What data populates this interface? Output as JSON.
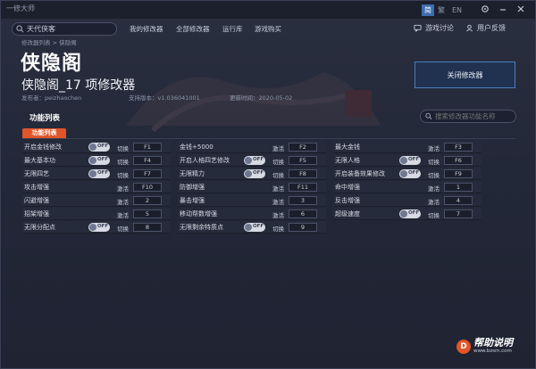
{
  "window": {
    "title": "一修大师"
  },
  "language": {
    "active": "简",
    "options": [
      "繁",
      "EN"
    ]
  },
  "search": {
    "value": "天代侠客"
  },
  "nav": [
    "我的修改器",
    "全部修改器",
    "运行库",
    "游戏购买"
  ],
  "top_buttons": {
    "forum": "游戏讨论",
    "feedback": "用户反馈"
  },
  "breadcrumb": "修改器列表 > 侠隐阁",
  "game": {
    "title": "侠隐阁",
    "subtitle": "侠隐阁_17 项修改器",
    "publisher": "发布者：peizhaochen",
    "version": "支持版本：v1.036041001",
    "updated": "更新时间：2020-05-02"
  },
  "close_button": "关闭修改器",
  "features": {
    "title": "功能列表",
    "search_placeholder": "搜索修改器功能名称",
    "tab": "功能列表"
  },
  "columns": [
    [
      {
        "label": "开启金钱修改",
        "toggle": "OFF",
        "mode": "切换",
        "key": "F1"
      },
      {
        "label": "最大基本功",
        "toggle": "OFF",
        "mode": "切换",
        "key": "F4"
      },
      {
        "label": "无限四艺",
        "toggle": "OFF",
        "mode": "切换",
        "key": "F7"
      },
      {
        "label": "攻击增强",
        "toggle": "",
        "mode": "激活",
        "key": "F10"
      },
      {
        "label": "闪避增强",
        "toggle": "",
        "mode": "激活",
        "key": "2"
      },
      {
        "label": "招架增强",
        "toggle": "",
        "mode": "激活",
        "key": "5"
      },
      {
        "label": "无限分配点",
        "toggle": "OFF",
        "mode": "切换",
        "key": "8"
      }
    ],
    [
      {
        "label": "金钱+5000",
        "toggle": "",
        "mode": "激活",
        "key": "F2"
      },
      {
        "label": "开启人格四艺修改",
        "toggle": "OFF",
        "mode": "切换",
        "key": "F5"
      },
      {
        "label": "无限精力",
        "toggle": "OFF",
        "mode": "切换",
        "key": "F8"
      },
      {
        "label": "防御增强",
        "toggle": "",
        "mode": "激活",
        "key": "F11"
      },
      {
        "label": "暴击增强",
        "toggle": "",
        "mode": "激活",
        "key": "3"
      },
      {
        "label": "移动帮数增强",
        "toggle": "",
        "mode": "激活",
        "key": "6"
      },
      {
        "label": "无限剩余特质点",
        "toggle": "OFF",
        "mode": "切换",
        "key": "9"
      }
    ],
    [
      {
        "label": "最大金钱",
        "toggle": "",
        "mode": "激活",
        "key": "F3"
      },
      {
        "label": "无限人格",
        "toggle": "OFF",
        "mode": "切换",
        "key": "F6"
      },
      {
        "label": "开启装备效果修改",
        "toggle": "OFF",
        "mode": "切换",
        "key": "F9"
      },
      {
        "label": "命中增强",
        "toggle": "",
        "mode": "激活",
        "key": "1"
      },
      {
        "label": "反击增强",
        "toggle": "",
        "mode": "激活",
        "key": "4"
      },
      {
        "label": "超级速度",
        "toggle": "OFF",
        "mode": "切换",
        "key": "7"
      }
    ]
  ],
  "watermark": {
    "circle": "D",
    "brand": "帮助说明",
    "url": "www.bzsm.com"
  }
}
